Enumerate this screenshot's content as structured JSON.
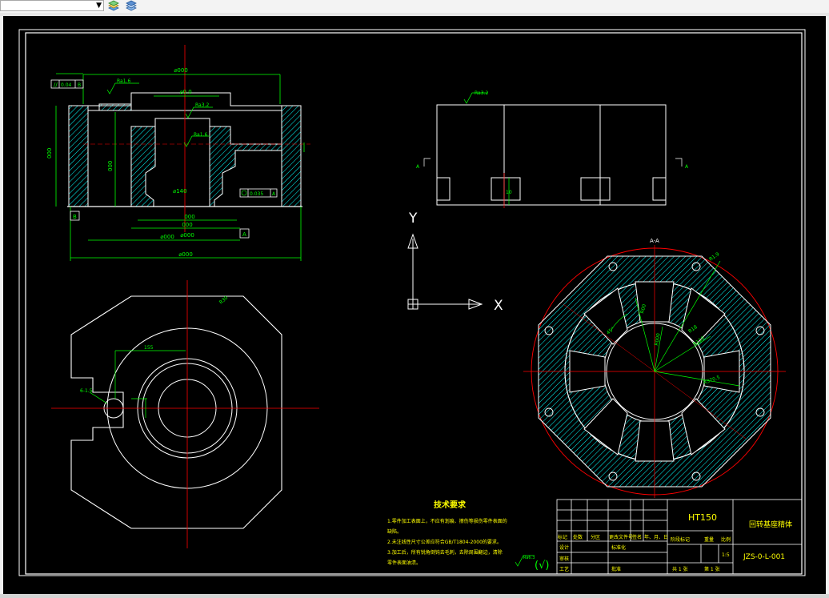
{
  "toolbar": {
    "layer_value": "",
    "icons": [
      "layer-properties-icon",
      "layer-states-icon"
    ]
  },
  "colors": {
    "background": "#000000",
    "geometry": "#ffffff",
    "dimension": "#00ff00",
    "centerline": "#ff0000",
    "hatch": "#00ffff",
    "annotation_text": "#ffff00"
  },
  "drawing": {
    "section_view": {
      "dims": [
        "⌀000",
        "⌀0.0",
        "000",
        "000",
        "⌀000",
        "⌀000",
        "⌀000",
        "000",
        "000"
      ],
      "flatness": "0.04",
      "flatness_datum": "B",
      "roughness": [
        "Ra1.6",
        "Ra3.2",
        "Ra1.6"
      ],
      "position_tol": "0.035",
      "position_datum": "A",
      "datum_a": "A",
      "datum_b": "B",
      "diameter_note": "⌀140"
    },
    "front_view": {
      "roughness": "Ra3.2",
      "section_mark_left": "A",
      "section_mark_right": "A",
      "slot_dim": "10"
    },
    "ucs": {
      "x_label": "X",
      "y_label": "Y"
    },
    "top_view": {
      "dim_a": "155",
      "dim_b": "R30",
      "dim_c": "6-1.5"
    },
    "section_a_view": {
      "title": "A-A",
      "dims": [
        "R18",
        "R110",
        "45°",
        "R370.5",
        "R00",
        "R000",
        "R1.9"
      ]
    },
    "tech_requirements": {
      "title": "技术要求",
      "items": [
        "1.零件加工表面上，不应有划痕、擦伤等损伤零件表面的",
        "缺陷。",
        "2.未注线性尺寸公差应符合GB/T1804-2000的要求。",
        "3.加工后，所有锐角倒钝去毛刺，去除周围翻边，清除",
        "零件表面油渍。"
      ],
      "roughness_symbol": "Ra6.3",
      "roughness_suffix": "(√)"
    },
    "title_block": {
      "material": "HT150",
      "part_name": "回转基座精体",
      "drawing_no": "JZS-0-L-001",
      "header_labels": [
        "标记",
        "处数",
        "分区",
        "更改文件号",
        "签名",
        "年、月、日"
      ],
      "row_labels": [
        "设计",
        "标准化",
        "审核",
        "工艺",
        "批准"
      ],
      "stage_label": "阶段标记",
      "weight_label": "重量",
      "scale_label": "比例",
      "scale_value": "1:5",
      "sheets_total": "共 1 张",
      "sheet_no": "第 1 张"
    }
  }
}
